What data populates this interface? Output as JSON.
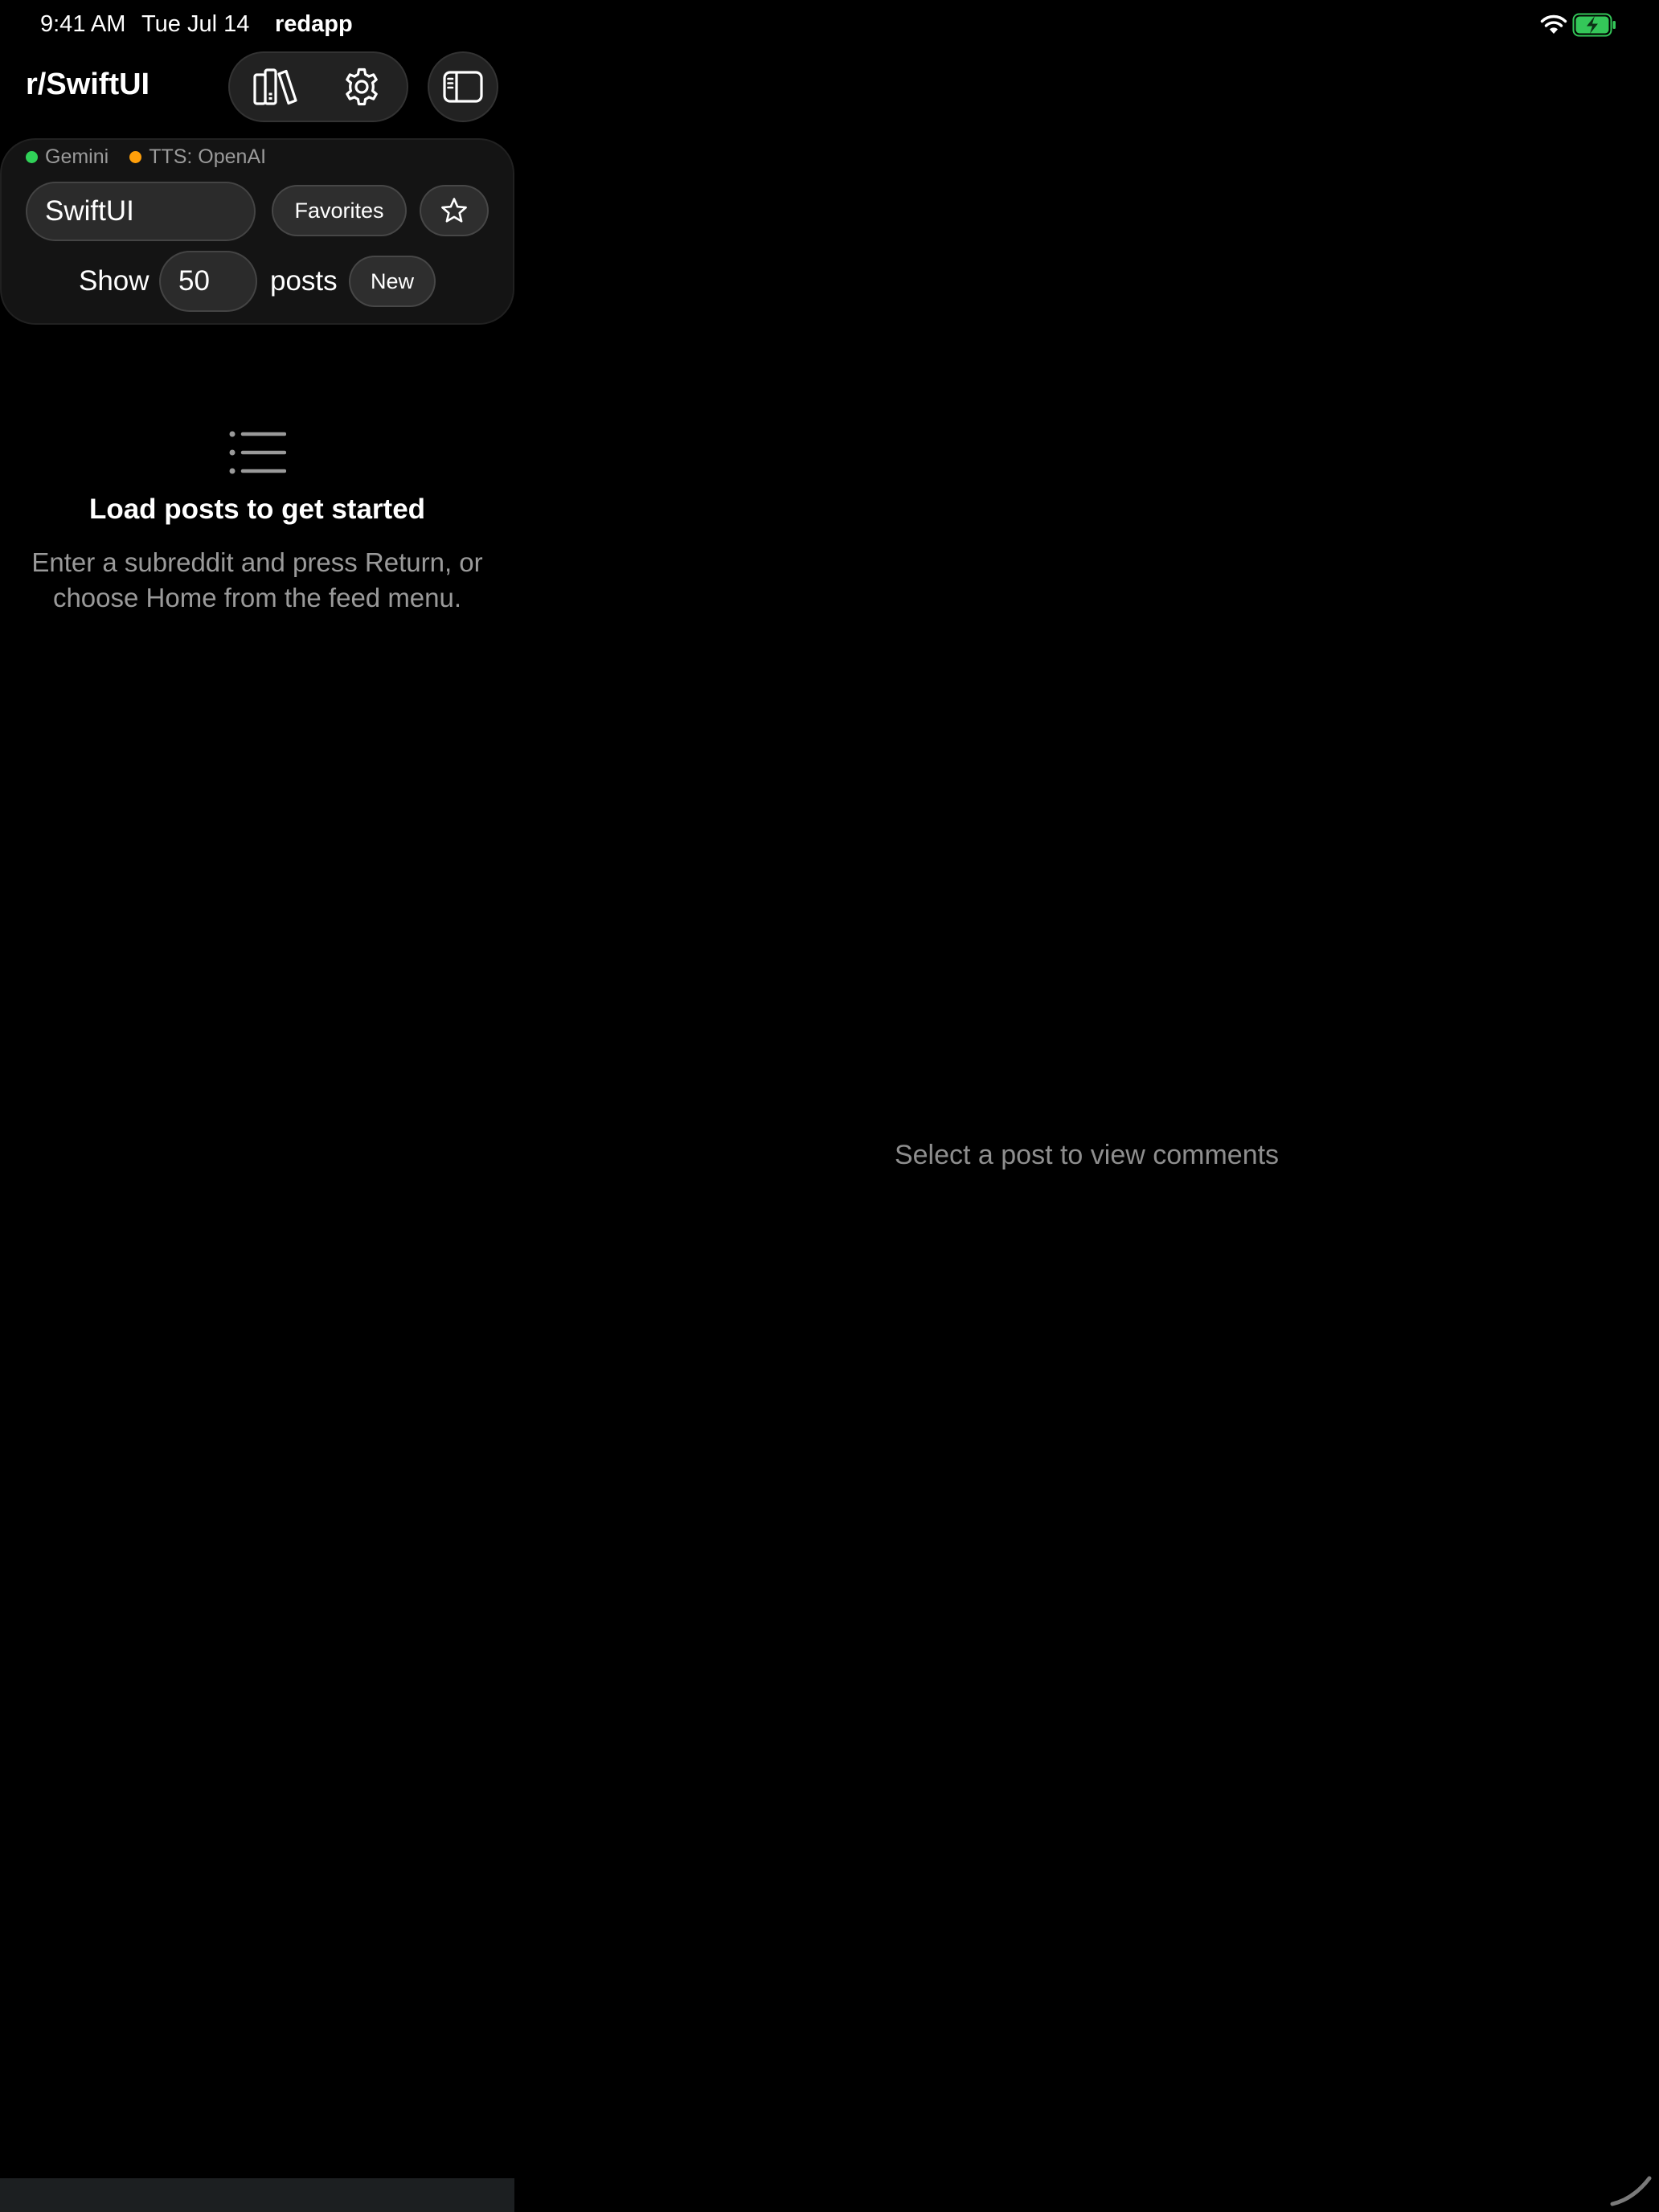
{
  "status_bar": {
    "time": "9:41 AM",
    "date": "Tue Jul 14",
    "app_name": "redapp",
    "wifi_icon": "wifi-icon",
    "battery_icon": "battery-charging-icon",
    "battery_color": "#34c759"
  },
  "nav": {
    "title": "r/SwiftUI",
    "library_icon": "books-icon",
    "settings_icon": "gear-icon",
    "sidebar_icon": "sidebar-left-icon"
  },
  "services": [
    {
      "label": "Gemini",
      "color": "#30d158"
    },
    {
      "label": "TTS: OpenAI",
      "color": "#ff9f0a"
    }
  ],
  "controls": {
    "subreddit_value": "SwiftUI",
    "favorites_label": "Favorites",
    "star_icon": "star-icon",
    "show_label": "Show",
    "post_count": "50",
    "posts_label": "posts",
    "sort_label": "New"
  },
  "empty_state": {
    "icon": "list-bullet-icon",
    "title": "Load posts to get started",
    "message": "Enter a subreddit and press Return, or choose Home from the feed menu."
  },
  "detail": {
    "placeholder": "Select a post to view comments"
  }
}
